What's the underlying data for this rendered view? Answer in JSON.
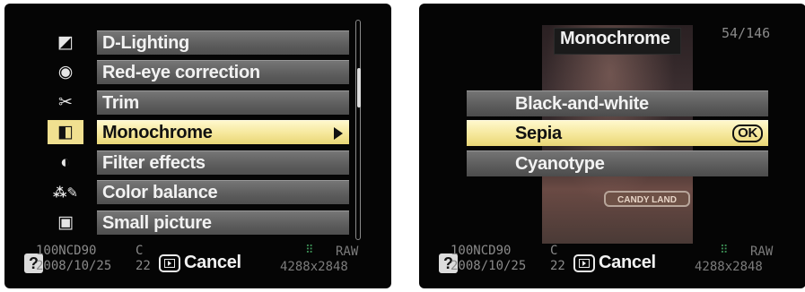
{
  "left_screen": {
    "menu_items": [
      {
        "label": "D-Lighting",
        "icon": "d-lighting-icon",
        "glyph": "◩"
      },
      {
        "label": "Red-eye correction",
        "icon": "eye-icon",
        "glyph": "◉"
      },
      {
        "label": "Trim",
        "icon": "scissors-icon",
        "glyph": "✂"
      },
      {
        "label": "Monochrome",
        "icon": "monochrome-icon",
        "glyph": "◧",
        "selected": true
      },
      {
        "label": "Filter effects",
        "icon": "filter-drop-icon",
        "glyph": "◐"
      },
      {
        "label": "Color balance",
        "icon": "color-balance-icon",
        "glyph": "⁂✎"
      },
      {
        "label": "Small picture",
        "icon": "small-picture-icon",
        "glyph": "▣"
      }
    ]
  },
  "right_screen": {
    "title": "Monochrome",
    "counter": "54/146",
    "options": [
      {
        "label": "Black-and-white"
      },
      {
        "label": "Sepia",
        "selected": true,
        "badge": "OK"
      },
      {
        "label": "Cyanotype"
      }
    ],
    "photo_sign_text": "CANDY LAND"
  },
  "info_bar": {
    "help": "?",
    "folder": "100NCD90",
    "date": "2008/10/25",
    "time_top": "C",
    "time": "22",
    "cancel_label": "Cancel",
    "quality": "RAW",
    "resolution": "4288x2848"
  },
  "colors": {
    "highlight": "#f5e79a",
    "row_gray": "#5c5c5c",
    "raw_icon": "#3c8f55"
  }
}
